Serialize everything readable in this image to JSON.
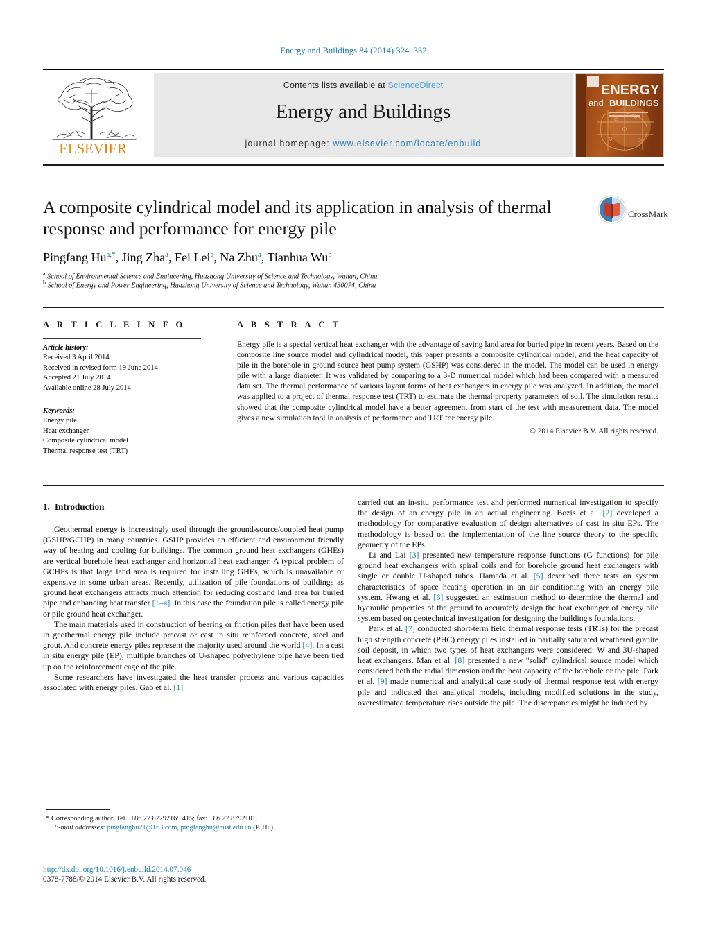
{
  "running_head": "Energy and Buildings 84 (2014) 324–332",
  "masthead": {
    "contents_prefix": "Contents lists available at ",
    "sciencedirect": "ScienceDirect",
    "journal_name": "Energy and Buildings",
    "homepage_prefix": "journal homepage: ",
    "homepage_url": "www.elsevier.com/locate/enbuild",
    "publisher": "ELSEVIER",
    "cover": {
      "line1": "ENERGY",
      "line2": "and",
      "line3": "BUILDINGS"
    },
    "colors": {
      "link": "#2f7fb5",
      "sciencedirect": "#4aa3d4",
      "elsevier_orange": "#F08000",
      "panel_bg": "#e8e8e8",
      "cover_bg": "#9c4a1a"
    }
  },
  "crossmark": {
    "label": "CrossMark"
  },
  "article": {
    "title": "A composite cylindrical model and its application in analysis of thermal response and performance for energy pile",
    "authors_html": "Pingfang Hu<sup>a,*</sup>, Jing Zha<sup>a</sup>, Fei Lei<sup>a</sup>, Na Zhu<sup>a</sup>, Tianhua Wu<sup>b</sup>",
    "affiliations": [
      "School of Environmental Science and Engineering, Huazhong University of Science and Technology, Wuhan, China",
      "School of Energy and Power Engineering, Huazhong University of Science and Technology, Wuhan 430074, China"
    ]
  },
  "article_info": {
    "heading": "A R T I C L E   I N F O",
    "history_label": "Article history:",
    "history": [
      "Received 3 April 2014",
      "Received in revised form 19 June 2014",
      "Accepted 21 July 2014",
      "Available online 28 July 2014"
    ],
    "keywords_label": "Keywords:",
    "keywords": [
      "Energy pile",
      "Heat exchanger",
      "Composite cylindrical model",
      "Thermal response test (TRT)"
    ]
  },
  "abstract": {
    "heading": "A B S T R A C T",
    "text": "Energy pile is a special vertical heat exchanger with the advantage of saving land area for buried pipe in recent years. Based on the composite line source model and cylindrical model, this paper presents a composite cylindrical model, and the heat capacity of pile in the borehole in ground source heat pump system (GSHP) was considered in the model. The model can be used in energy pile with a large diameter. It was validated by comparing to a 3-D numerical model which had been compared with a measured data set. The thermal performance of various layout forms of heat exchangers in energy pile was analyzed. In addition, the model was applied to a project of thermal response test (TRT) to estimate the thermal property parameters of soil. The simulation results showed that the composite cylindrical model have a better agreement from start of the test with measurement data. The model gives a new simulation tool in analysis of performance and TRT for energy pile.",
    "copyright": "© 2014 Elsevier B.V. All rights reserved."
  },
  "body": {
    "section_number": "1.",
    "section_title": "Introduction",
    "left_paragraphs": [
      "Geothermal energy is increasingly used through the ground-source/coupled heat pump (GSHP/GCHP) in many countries. GSHP provides an efficient and environment friendly way of heating and cooling for buildings. The common ground heat exchangers (GHEs) are vertical borehole heat exchanger and horizontal heat exchanger. A typical problem of GCHPs is that large land area is required for installing GHEs, which is unavailable or expensive in some urban areas. Recently, utilization of pile foundations of buildings as ground heat exchangers attracts much attention for reducing cost and land area for buried pipe and enhancing heat transfer [1–4]. In this case the foundation pile is called energy pile or pile ground heat exchanger.",
      "The main materials used in construction of bearing or friction piles that have been used in geothermal energy pile include precast or cast in situ reinforced concrete, steel and grout. And concrete energy piles represent the majority used around the world [4]. In a cast in situ energy pile (EP), multiple branches of U-shaped polyethylene pipe have been tied up on the reinforcement cage of the pile.",
      "Some researchers have investigated the heat transfer process and various capacities associated with energy piles. Gao et al. [1]"
    ],
    "right_paragraphs": [
      "carried out an in-situ performance test and performed numerical investigation to specify the design of an energy pile in an actual engineering. Bozis et al. [2] developed a methodology for comparative evaluation of design alternatives of cast in situ EPs. The methodology is based on the implementation of the line source theory to the specific geometry of the EPs.",
      "Li and Lai [3] presented new temperature response functions (G functions) for pile ground heat exchangers with spiral coils and for borehole ground heat exchangers with single or double U-shaped tubes. Hamada et al. [5] described three tests on system characteristics of space heating operation in an air conditioning with an energy pile system. Hwang et al. [6] suggested an estimation method to determine the thermal and hydraulic properties of the ground to accurately design the heat exchanger of energy pile system based on geotechnical investigation for designing the building's foundations.",
      "Park et al. [7] conducted short-term field thermal response tests (TRTs) for the precast high strength concrete (PHC) energy piles installed in partially saturated weathered granite soil deposit, in which two types of heat exchangers were considered: W and 3U-shaped heat exchangers. Man et al. [8] presented a new \"solid\" cylindrical source model which considered both the radial dimension and the heat capacity of the borehole or the pile. Park et al. [9] made numerical and analytical case study of thermal response test with energy pile and indicated that analytical models, including modified solutions in the study, overestimated temperature rises outside the pile. The discrepancies might be induced by"
    ]
  },
  "footer": {
    "corresponding_marker": "*",
    "corresponding": "Corresponding author. Tel.: +86 27 87792165 415; fax: +86 27 8792101.",
    "email_label": "E-mail addresses:",
    "email1": "pingfanghu21@163.com",
    "email2": "pingfanghu@hust.edu.cn",
    "email_attrib": "(P. Hu).",
    "doi": "http://dx.doi.org/10.1016/j.enbuild.2014.07.046",
    "issn": "0378-7788/© 2014 Elsevier B.V. All rights reserved."
  }
}
